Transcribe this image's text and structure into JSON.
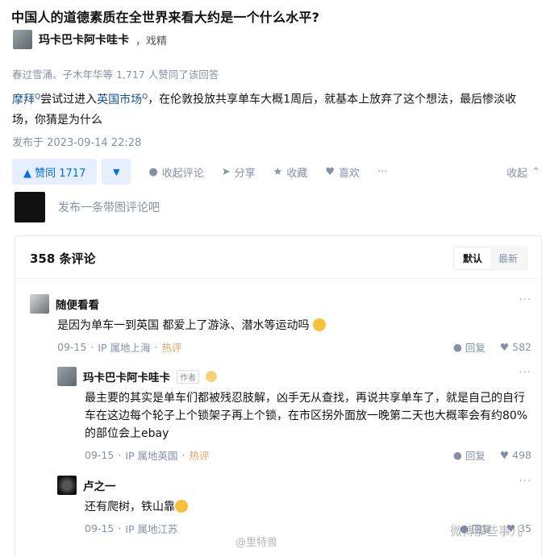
{
  "question": {
    "title": "中国人的道德素质在全世界来看大约是一个什么水平?"
  },
  "author": {
    "name": "玛卡巴卡阿卡哇卡",
    "suffix": "，戏精"
  },
  "upvoters_text": "春过雪涌、子木年华等 1,717 人赞同了该回答",
  "content": {
    "link1": "摩拜",
    "text1": "尝试过进入",
    "link2": "英国市场",
    "text2": "，在伦敦投放共享单车大概1周后，就基本上放弃了这个想法，最后惨淡收场，你猜是为什么",
    "search_mark": "Q"
  },
  "published": "发布于 2023-09-14 22:28",
  "actions": {
    "vote_up": "▲ 赞同 1717",
    "vote_down": "▼",
    "comment": "收起评论",
    "share": "分享",
    "favorite": "收藏",
    "like": "喜欢",
    "more": "···",
    "collapse": "收起"
  },
  "comment_input": {
    "placeholder": "发布一条带图评论吧"
  },
  "comments_panel": {
    "count_label": "358 条评论",
    "sort": [
      "默认",
      "最新"
    ],
    "items": [
      {
        "author": "随便看看",
        "text": "是因为单车一到英国 都爱上了游泳、潜水等运动吗",
        "date": "09-15",
        "ip": "IP 属地上海",
        "hot": "热评",
        "reply": "回复",
        "likes": "582"
      },
      {
        "author": "玛卡巴卡阿卡哇卡",
        "badge": "作者",
        "text": "最主要的其实是单车们都被残忍肢解，凶手无从查找，再说共享单车了，就是自己的自行车在这边每个轮子上个锁架子再上个锁，在市区拐外面放一晚第二天也大概率会有约80%的部位会上ebay",
        "date": "09-15",
        "ip": "IP 属地英国",
        "hot": "热评",
        "reply": "回复",
        "likes": "498"
      },
      {
        "author": "卢之一",
        "text": "还有爬树，铁山靠",
        "date": "09-15",
        "ip": "IP 属地江苏",
        "reply": "回复",
        "likes": "35"
      }
    ]
  },
  "watermarks": {
    "center": "@里特兽",
    "right": "微博那些事儿"
  }
}
